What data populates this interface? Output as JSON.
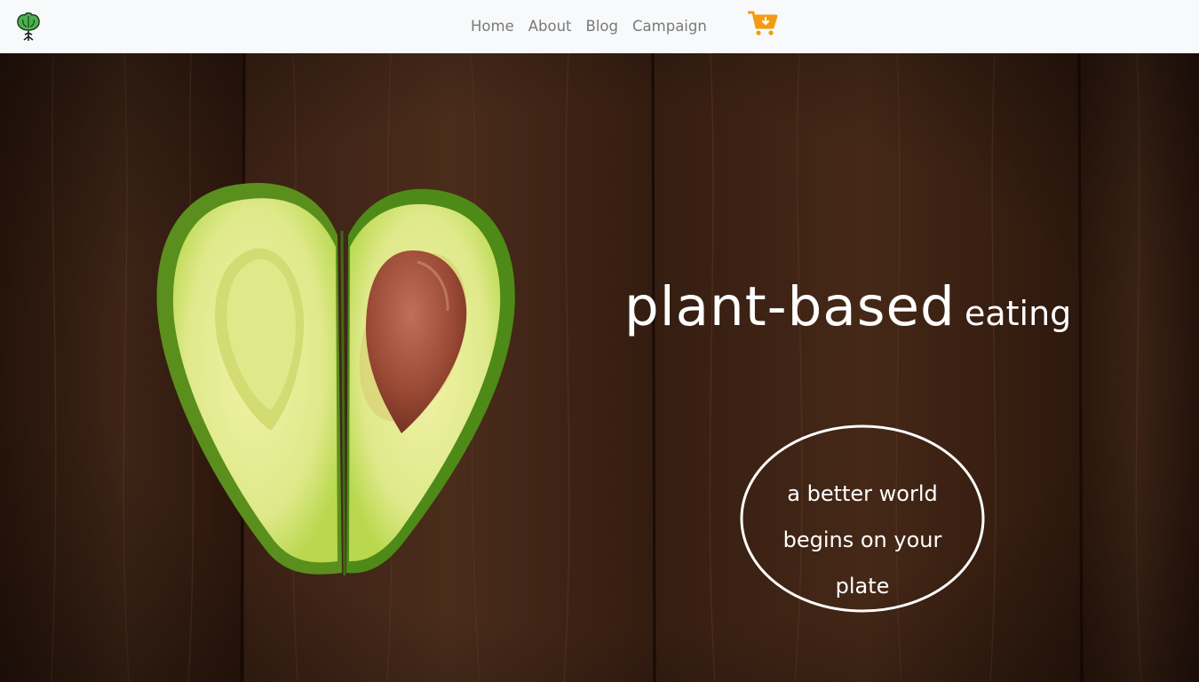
{
  "navbar": {
    "logo_icon": "leaf-tree-logo-icon",
    "links": [
      "Home",
      "About",
      "Blog",
      "Campaign"
    ],
    "cart_icon": "shopping-cart-download-icon"
  },
  "hero": {
    "background": "dark-wood-planks-with-heart-shaped-avocado-halves",
    "title_main": "plant-based",
    "title_sub": "eating",
    "slogan_lines": [
      "a better world",
      "begins on your",
      "plate"
    ]
  },
  "colors": {
    "navbar_bg": "#f8f9fa",
    "nav_link": "#7a7a7a",
    "cart": "#f39c12",
    "logo_green": "#43a047",
    "hero_text": "#ffffff"
  }
}
